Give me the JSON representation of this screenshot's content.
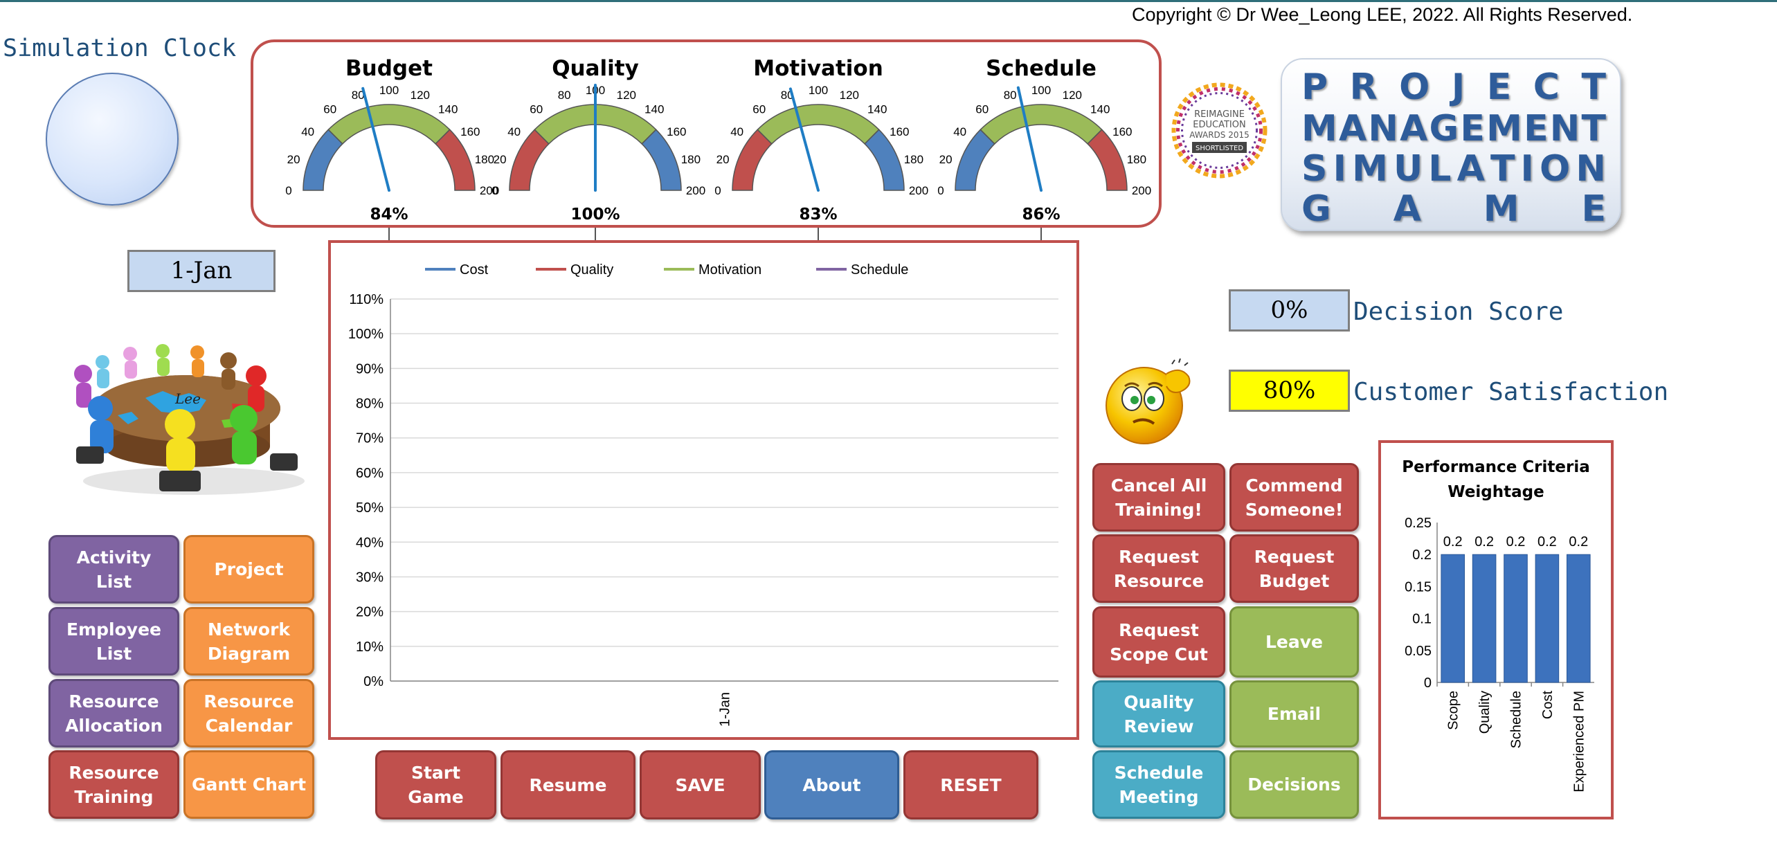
{
  "copyright": "Copyright © Dr Wee_Leong LEE, 2022.  All Rights Reserved.",
  "simulation_clock": {
    "title": "Simulation Clock"
  },
  "current_date": "1-Jan",
  "gauges": [
    {
      "title": "Budget",
      "value": 84,
      "label": "84%",
      "ticks": [
        "0",
        "20",
        "40",
        "60",
        "80",
        "100",
        "120",
        "140",
        "160",
        "180",
        "200"
      ]
    },
    {
      "title": "Quality",
      "value": 100,
      "label": "100%",
      "ticks": [
        "0",
        "20",
        "40",
        "60",
        "80",
        "100",
        "120",
        "140",
        "160",
        "180",
        "200"
      ]
    },
    {
      "title": "Motivation",
      "value": 83,
      "label": "83%",
      "ticks": [
        "0",
        "20",
        "40",
        "60",
        "80",
        "100",
        "120",
        "140",
        "160",
        "180",
        "200"
      ]
    },
    {
      "title": "Schedule",
      "value": 86,
      "label": "86%",
      "ticks": [
        "0",
        "20",
        "40",
        "60",
        "80",
        "100",
        "120",
        "140",
        "160",
        "180",
        "200"
      ]
    }
  ],
  "colors": {
    "accent_red": "#c0504d",
    "gauge_blue": "#4f81bd",
    "gauge_green": "#9bbb59",
    "gauge_red": "#c0504d",
    "needle": "#1f7dc4",
    "purple_btn": "#8064a2",
    "orange_btn": "#f79646",
    "teal_btn": "#4bacc6"
  },
  "chart_data": [
    {
      "type": "line",
      "series": [
        {
          "name": "Cost",
          "color": "#4f81bd",
          "values": []
        },
        {
          "name": "Quality",
          "color": "#c0504d",
          "values": []
        },
        {
          "name": "Motivation",
          "color": "#9bbb59",
          "values": []
        },
        {
          "name": "Schedule",
          "color": "#8064a2",
          "values": []
        }
      ],
      "categories": [
        "1-Jan"
      ],
      "yticks": [
        "0%",
        "10%",
        "20%",
        "30%",
        "40%",
        "50%",
        "60%",
        "70%",
        "80%",
        "90%",
        "100%",
        "110%"
      ],
      "ylim": [
        0,
        1.1
      ],
      "legend": "top",
      "grid": true
    },
    {
      "type": "bar",
      "title": "Performance Criteria Weightage",
      "categories": [
        "Scope",
        "Quality",
        "Schedule",
        "Cost",
        "Experienced PM"
      ],
      "values": [
        0.2,
        0.2,
        0.2,
        0.2,
        0.2
      ],
      "data_labels": [
        "0.2",
        "0.2",
        "0.2",
        "0.2",
        "0.2"
      ],
      "yticks": [
        "0",
        "0.05",
        "0.1",
        "0.15",
        "0.2",
        "0.25"
      ],
      "ylim": [
        0,
        0.25
      ]
    }
  ],
  "left_buttons": [
    {
      "label": "Activity\nList",
      "style": "purple"
    },
    {
      "label": "Project",
      "style": "orange"
    },
    {
      "label": "Employee\nList",
      "style": "purple"
    },
    {
      "label": "Network\nDiagram",
      "style": "orange"
    },
    {
      "label": "Resource\nAllocation",
      "style": "purple"
    },
    {
      "label": "Resource\nCalendar",
      "style": "orange"
    },
    {
      "label": "Resource\nTraining",
      "style": "red"
    },
    {
      "label": "Gantt Chart",
      "style": "orange"
    }
  ],
  "bottom_buttons": [
    {
      "label": "Start\nGame",
      "style": "red"
    },
    {
      "label": "Resume",
      "style": "red"
    },
    {
      "label": "SAVE",
      "style": "red"
    },
    {
      "label": "About",
      "style": "blue"
    },
    {
      "label": "RESET",
      "style": "red"
    }
  ],
  "right_buttons": [
    {
      "label": "Cancel All\nTraining!",
      "style": "red"
    },
    {
      "label": "Commend\nSomeone!",
      "style": "red"
    },
    {
      "label": "Request\nResource",
      "style": "red"
    },
    {
      "label": "Request\nBudget",
      "style": "red"
    },
    {
      "label": "Request\nScope Cut",
      "style": "red"
    },
    {
      "label": "Leave",
      "style": "green"
    },
    {
      "label": "Quality\nReview",
      "style": "teal"
    },
    {
      "label": "Email",
      "style": "green"
    },
    {
      "label": "Schedule\nMeeting",
      "style": "teal"
    },
    {
      "label": "Decisions",
      "style": "green"
    }
  ],
  "logo": {
    "lines": [
      [
        "P",
        "R",
        "O",
        "J",
        "E",
        "C",
        "T"
      ],
      [
        "M",
        "A",
        "N",
        "A",
        "G",
        "E",
        "M",
        "E",
        "N",
        "T"
      ],
      [
        "S",
        "I",
        "M",
        "U",
        "L",
        "A",
        "T",
        "I",
        "O",
        "N"
      ],
      [
        "G",
        "A",
        "M",
        "E"
      ]
    ]
  },
  "award": {
    "line1": "REIMAGINE",
    "line2": "EDUCATION",
    "line3": "AWARDS 2015",
    "line4": "SHORTLISTED"
  },
  "decision_score": {
    "value": "0%",
    "label": "Decision Score"
  },
  "customer_satisfaction": {
    "value": "80%",
    "label": "Customer Satisfaction"
  },
  "meeting_image": {
    "caption": "Lee"
  }
}
